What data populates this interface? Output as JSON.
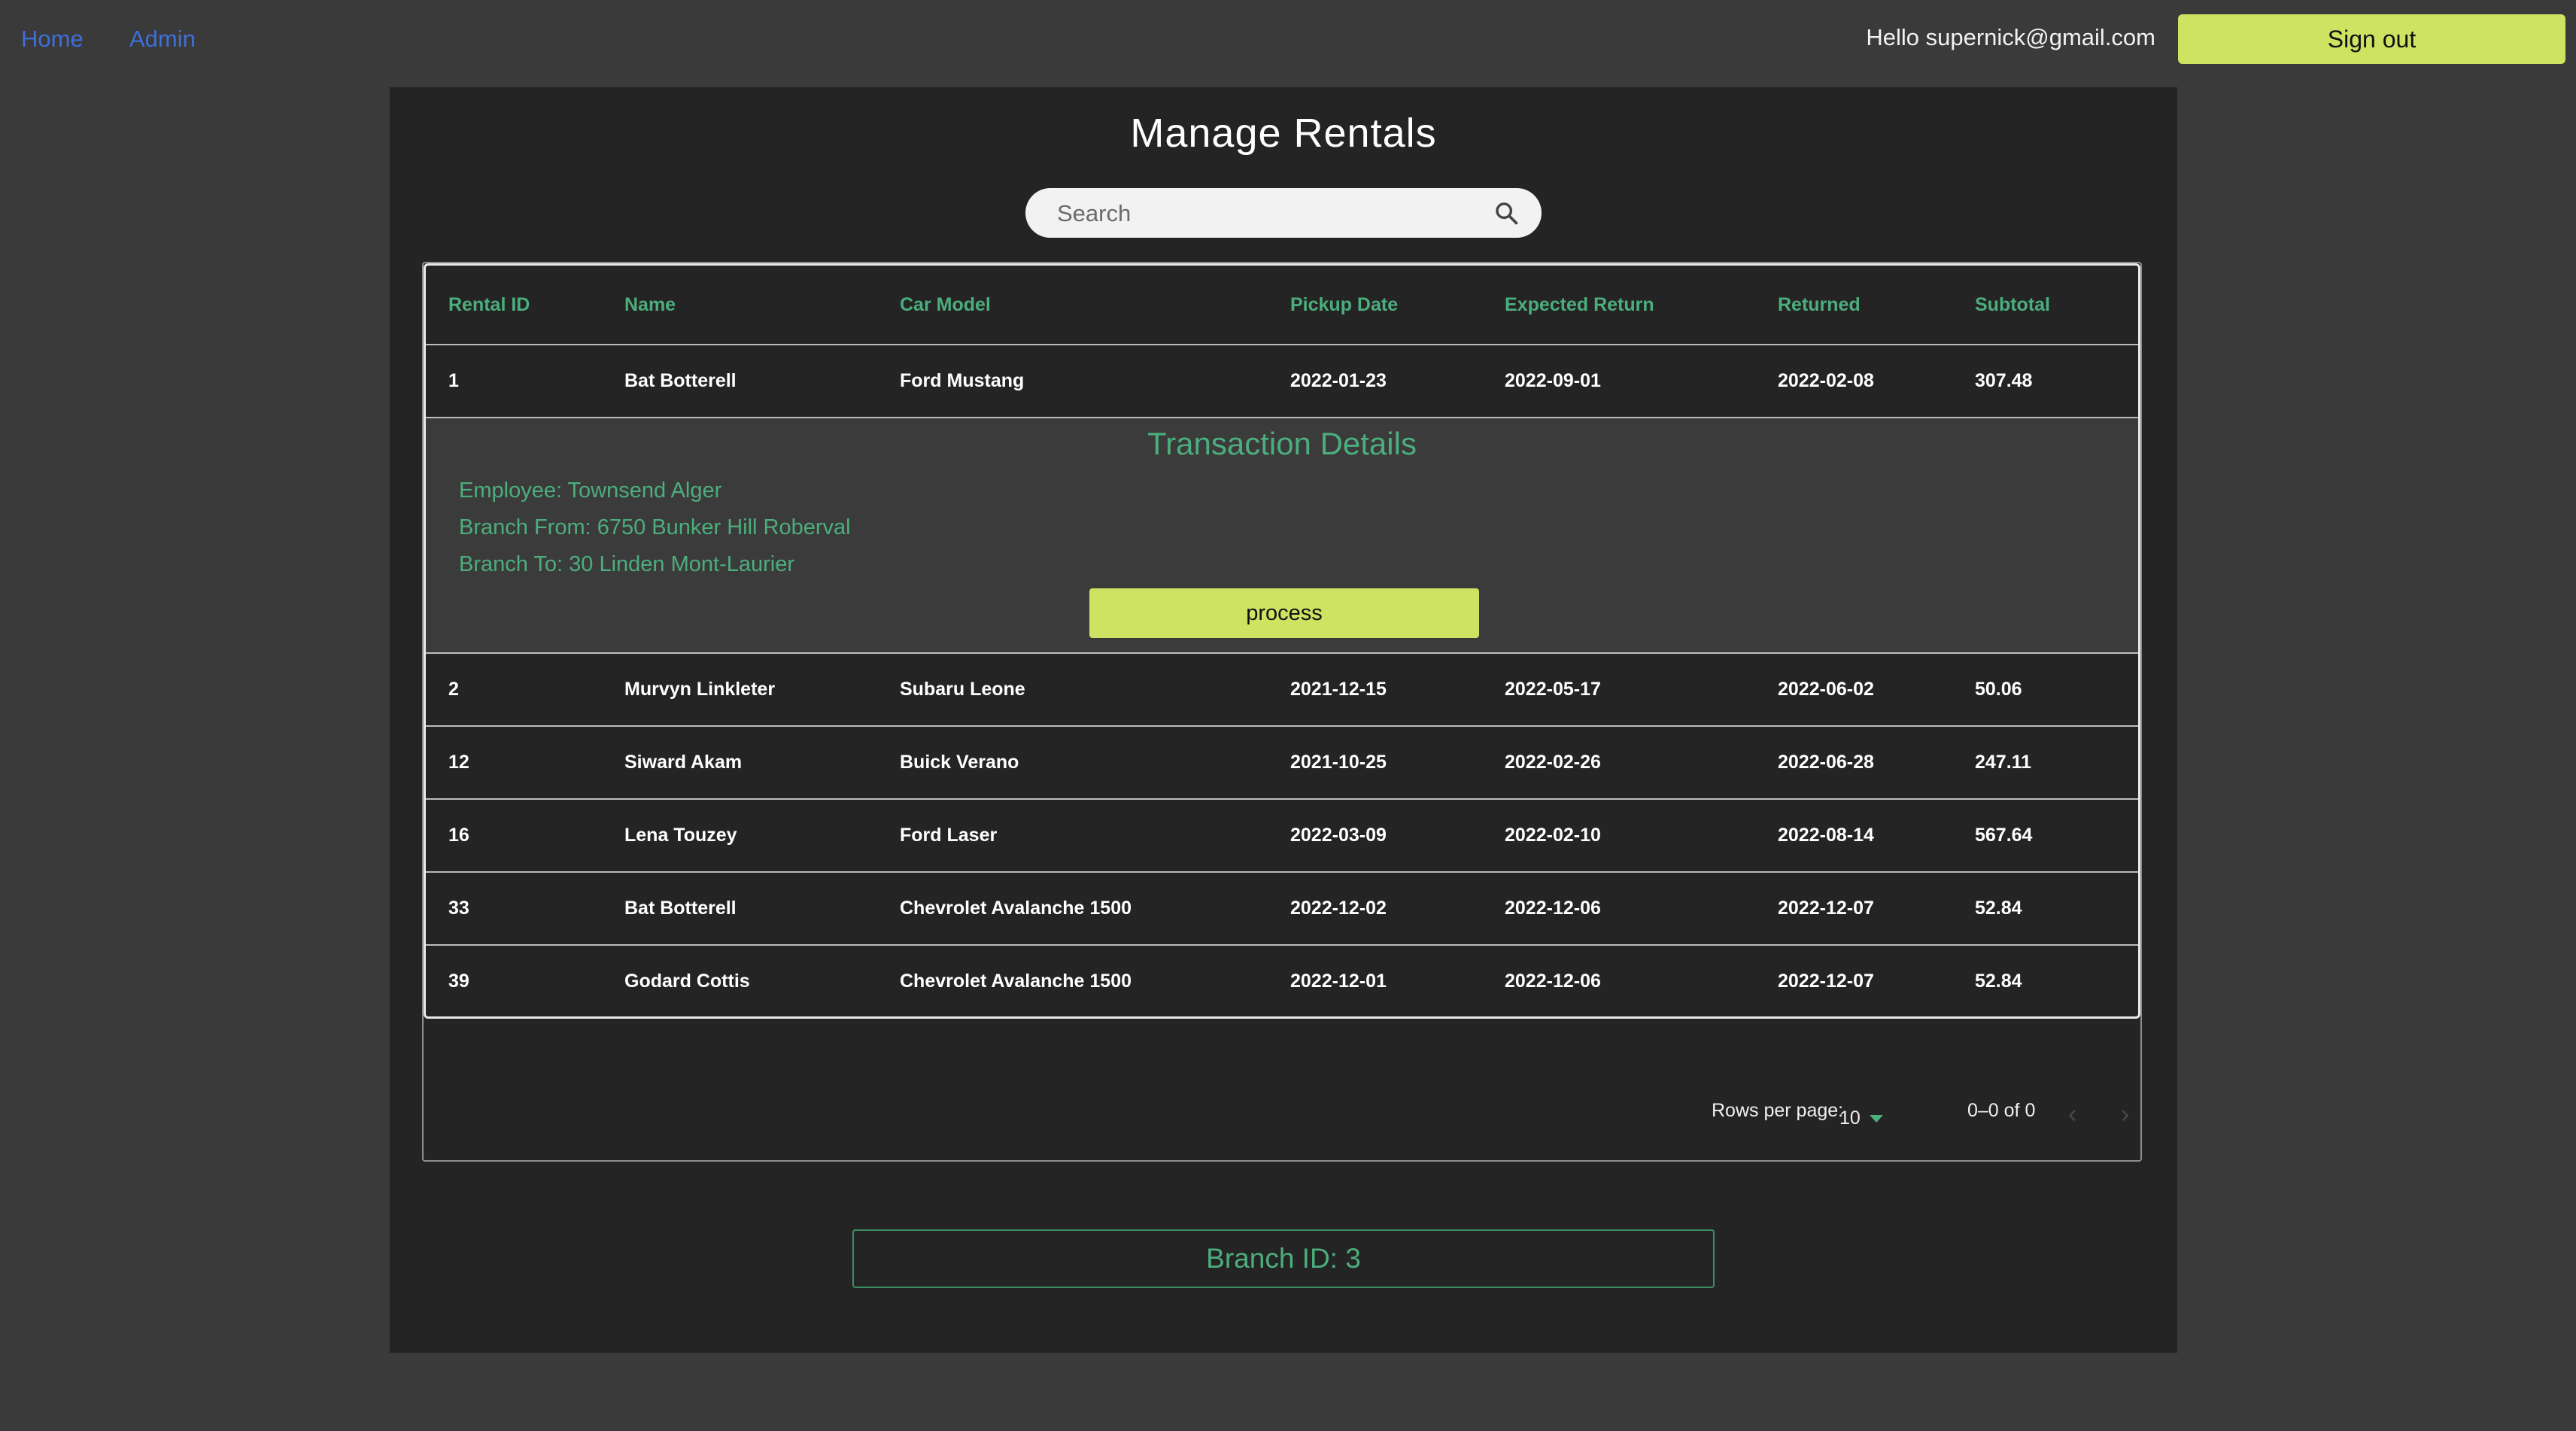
{
  "nav": {
    "home_label": "Home",
    "admin_label": "Admin",
    "greeting": "Hello supernick@gmail.com",
    "signout_label": "Sign out"
  },
  "page": {
    "title": "Manage Rentals"
  },
  "search": {
    "placeholder": "Search",
    "icon": "search-icon"
  },
  "table": {
    "columns": [
      "Rental ID",
      "Name",
      "Car Model",
      "Pickup Date",
      "Expected Return",
      "Returned",
      "Subtotal"
    ],
    "rows": [
      [
        "1",
        "Bat Botterell",
        "Ford Mustang",
        "2022-01-23",
        "2022-09-01",
        "2022-02-08",
        "307.48"
      ],
      [
        "2",
        "Murvyn Linkleter",
        "Subaru Leone",
        "2021-12-15",
        "2022-05-17",
        "2022-06-02",
        "50.06"
      ],
      [
        "12",
        "Siward Akam",
        "Buick Verano",
        "2021-10-25",
        "2022-02-26",
        "2022-06-28",
        "247.11"
      ],
      [
        "16",
        "Lena Touzey",
        "Ford Laser",
        "2022-03-09",
        "2022-02-10",
        "2022-08-14",
        "567.64"
      ],
      [
        "33",
        "Bat Botterell",
        "Chevrolet Avalanche 1500",
        "2022-12-02",
        "2022-12-06",
        "2022-12-07",
        "52.84"
      ],
      [
        "39",
        "Godard Cottis",
        "Chevrolet Avalanche 1500",
        "2022-12-01",
        "2022-12-06",
        "2022-12-07",
        "52.84"
      ]
    ]
  },
  "details": {
    "title": "Transaction Details",
    "employee": "Employee: Townsend Alger",
    "branch_from": "Branch From: 6750 Bunker Hill Roberval",
    "branch_to": "Branch To: 30 Linden Mont-Laurier",
    "process_label": "process"
  },
  "pagination": {
    "rows_per_page_label": "Rows per page:",
    "rows_per_page_value": "10",
    "range": "0–0 of 0",
    "prev_icon": "chevron-left-icon",
    "next_icon": "chevron-right-icon"
  },
  "branch": {
    "label": "Branch ID: 3"
  },
  "colors": {
    "accent_green": "#4cae7c",
    "button_lime": "#cde361",
    "link_blue": "#3f6fd8",
    "page_bg": "#3a3a3a",
    "panel_bg": "#242424"
  }
}
